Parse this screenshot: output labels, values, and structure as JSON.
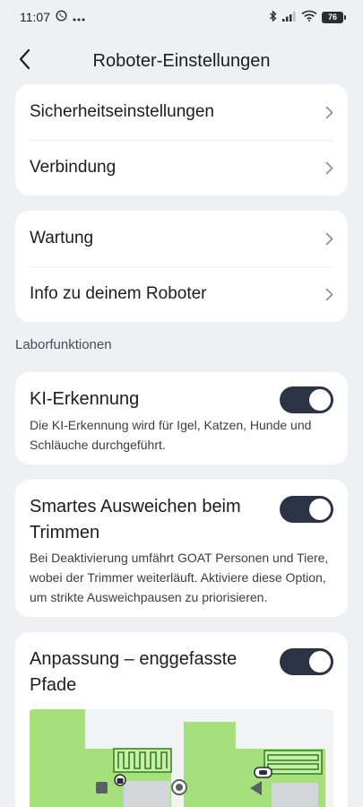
{
  "status_bar": {
    "time": "11:07",
    "battery": "76",
    "icons": [
      "whatsapp-icon",
      "more-dots-icon",
      "bluetooth-icon",
      "signal-icon",
      "wifi-icon",
      "battery-icon"
    ]
  },
  "header": {
    "title": "Roboter-Einstellungen",
    "back_icon": "chevron-left-icon"
  },
  "group1": {
    "items": [
      {
        "label": "Sicherheitseinstellungen"
      },
      {
        "label": "Verbindung"
      }
    ]
  },
  "group2": {
    "items": [
      {
        "label": "Wartung"
      },
      {
        "label": "Info zu deinem Roboter"
      }
    ]
  },
  "section": {
    "label": "Laborfunktionen"
  },
  "lab": {
    "ki": {
      "title": "KI-Erkennung",
      "description": "Die KI-Erkennung wird für Igel, Katzen, Hunde und Schläuche durchgeführt.",
      "enabled": true
    },
    "smart": {
      "title": "Smartes Ausweichen beim Trimmen",
      "description": "Bei Deaktivierung umfährt GOAT Personen und Tiere, wobei der Trimmer weiterläuft. Aktiviere diese Option, um strikte Ausweichpausen zu priorisieren.",
      "enabled": true
    },
    "paths": {
      "title": "Anpassung – enggefasste Pfade",
      "enabled": true
    }
  },
  "colors": {
    "background": "#eef0f4",
    "card": "#ffffff",
    "toggle_on": "#2a3444",
    "map_green": "#a6e07c",
    "map_pattern": "#2f7d21"
  }
}
